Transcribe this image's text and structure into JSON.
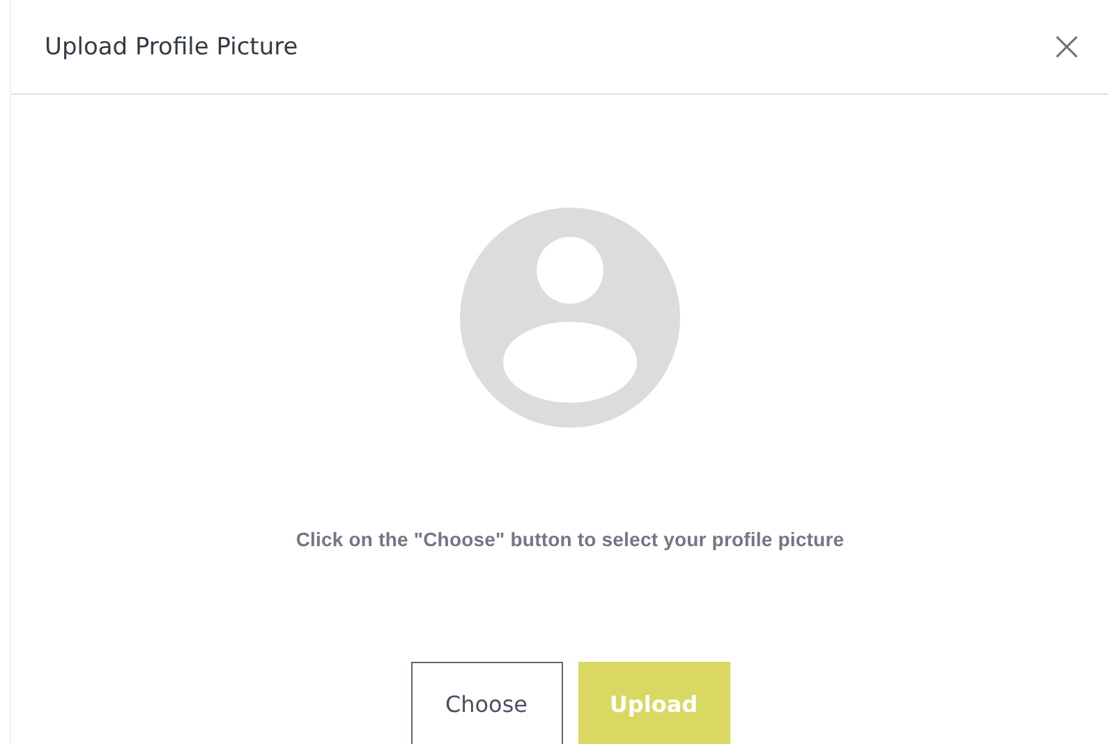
{
  "dialog": {
    "title": "Upload Profile Picture",
    "close": "×"
  },
  "instructions": "Click on the \"Choose\" button to select your profile picture",
  "buttons": [
    {
      "label": "Choose",
      "kind": "secondary"
    },
    {
      "label": "Upload",
      "kind": "primary"
    }
  ]
}
